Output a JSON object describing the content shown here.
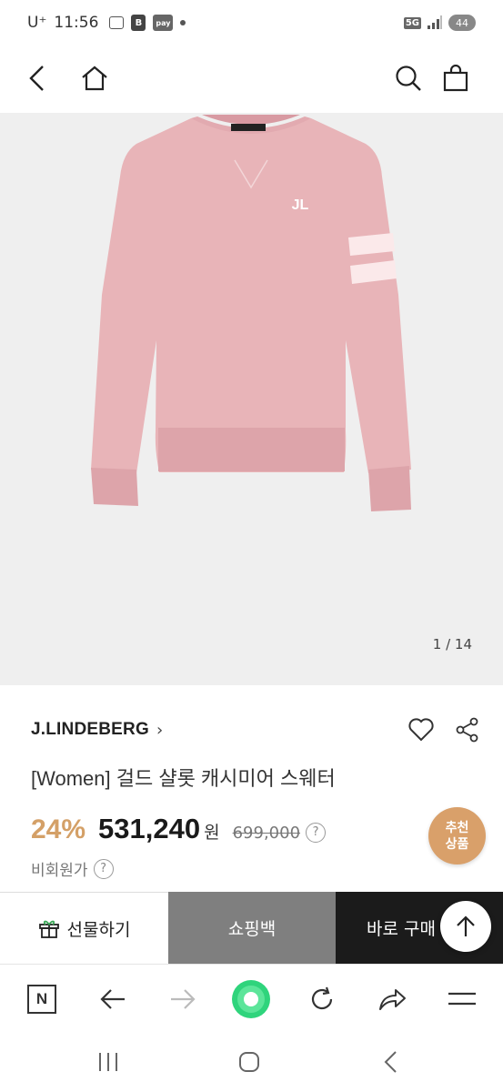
{
  "status_bar": {
    "carrier": "U⁺",
    "time": "11:56",
    "b_icon": "B",
    "pay_icon": "pay",
    "network": "5G",
    "battery": "44"
  },
  "header": {
    "icons": [
      "back-icon",
      "home-icon",
      "search-icon",
      "shopping-bag-icon"
    ]
  },
  "gallery": {
    "counter": "1 / 14"
  },
  "product": {
    "brand": "J.LINDEBERG",
    "brand_chevron": "›",
    "title": "[Women] 걸드 샬롯 캐시미어 스웨터",
    "discount": "24%",
    "price": "531,240",
    "currency": "원",
    "original_price": "699,000",
    "help": "?",
    "member_price_label": "비회원가",
    "recommend_line1": "추천",
    "recommend_line2": "상품"
  },
  "actions": {
    "gift": "선물하기",
    "shopping_bag": "쇼핑백",
    "buy_now": "바로 구매"
  },
  "browser": {
    "n_label": "N",
    "icons": [
      "naver-n-icon",
      "back-arrow-icon",
      "forward-arrow-icon",
      "green-dot-icon",
      "refresh-icon",
      "share-arrow-icon",
      "menu-icon"
    ]
  },
  "colors": {
    "discount": "#d4a067",
    "recommend_badge": "#d9a06a",
    "hero_bg": "#efefef",
    "sweater": "#e8b4b8",
    "shopping_bag_bg": "#7f7f7f",
    "buy_bg": "#1b1b1b",
    "green_dot": "#2fd47c"
  }
}
